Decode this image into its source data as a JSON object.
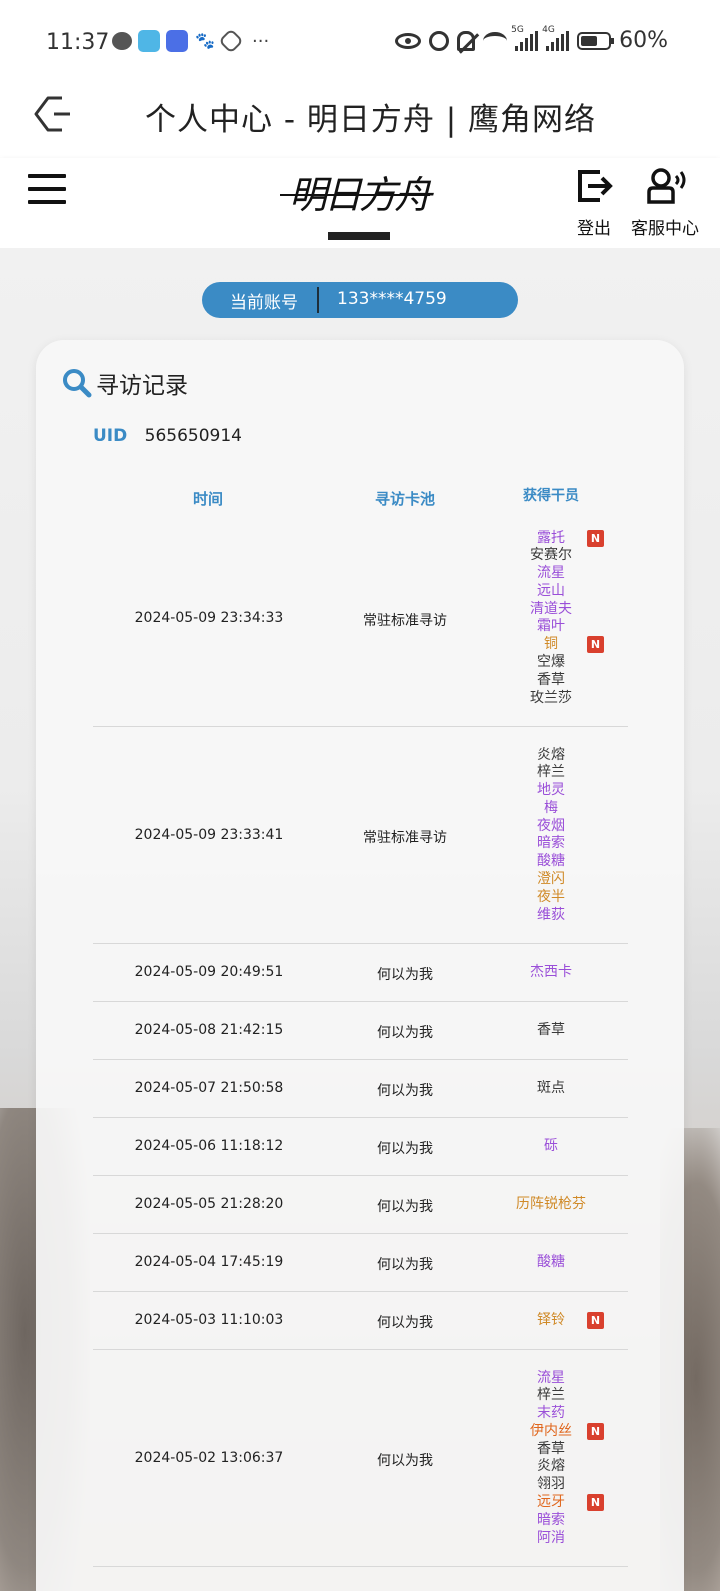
{
  "status_bar": {
    "time": "11:37",
    "notification_icons": [
      "chat-icon",
      "book-app-icon",
      "mail-app-icon",
      "baidu-icon",
      "hand-icon"
    ],
    "more": "···",
    "signal_label_1": "5G",
    "signal_label_2": "4G",
    "battery": "60%"
  },
  "titlebar": {
    "title": "个人中心 - 明日方舟 | 鹰角网络"
  },
  "header": {
    "logo_text": "明日方舟",
    "logout_label": "登出",
    "service_label": "客服中心"
  },
  "account": {
    "label": "当前账号",
    "value": "133****4759"
  },
  "record": {
    "title": "寻访记录",
    "uid_label": "UID",
    "uid_value": "565650914",
    "columns": [
      "时间",
      "寻访卡池",
      "获得干员"
    ],
    "rows": [
      {
        "time": "2024-05-09 23:34:33",
        "pool": "常驻标准寻访",
        "operators": [
          {
            "name": "露托",
            "rarity": 4,
            "new": true
          },
          {
            "name": "安赛尔",
            "rarity": 3,
            "new": false
          },
          {
            "name": "流星",
            "rarity": 4,
            "new": false
          },
          {
            "name": "远山",
            "rarity": 4,
            "new": false
          },
          {
            "name": "清道夫",
            "rarity": 4,
            "new": false
          },
          {
            "name": "霜叶",
            "rarity": 4,
            "new": false
          },
          {
            "name": "铜",
            "rarity": 5,
            "new": true
          },
          {
            "name": "空爆",
            "rarity": 3,
            "new": false
          },
          {
            "name": "香草",
            "rarity": 3,
            "new": false
          },
          {
            "name": "玫兰莎",
            "rarity": 3,
            "new": false
          }
        ]
      },
      {
        "time": "2024-05-09 23:33:41",
        "pool": "常驻标准寻访",
        "operators": [
          {
            "name": "炎熔",
            "rarity": 3,
            "new": false
          },
          {
            "name": "梓兰",
            "rarity": 3,
            "new": false
          },
          {
            "name": "地灵",
            "rarity": 4,
            "new": false
          },
          {
            "name": "梅",
            "rarity": 4,
            "new": false
          },
          {
            "name": "夜烟",
            "rarity": 4,
            "new": false
          },
          {
            "name": "暗索",
            "rarity": 4,
            "new": false
          },
          {
            "name": "酸糖",
            "rarity": 4,
            "new": false
          },
          {
            "name": "澄闪",
            "rarity": 5,
            "new": false
          },
          {
            "name": "夜半",
            "rarity": 5,
            "new": false
          },
          {
            "name": "维荻",
            "rarity": 4,
            "new": false
          }
        ]
      },
      {
        "time": "2024-05-09 20:49:51",
        "pool": "何以为我",
        "operators": [
          {
            "name": "杰西卡",
            "rarity": 4,
            "new": false
          }
        ]
      },
      {
        "time": "2024-05-08 21:42:15",
        "pool": "何以为我",
        "operators": [
          {
            "name": "香草",
            "rarity": 3,
            "new": false
          }
        ]
      },
      {
        "time": "2024-05-07 21:50:58",
        "pool": "何以为我",
        "operators": [
          {
            "name": "斑点",
            "rarity": 3,
            "new": false
          }
        ]
      },
      {
        "time": "2024-05-06 11:18:12",
        "pool": "何以为我",
        "operators": [
          {
            "name": "砾",
            "rarity": 4,
            "new": false
          }
        ]
      },
      {
        "time": "2024-05-05 21:28:20",
        "pool": "何以为我",
        "operators": [
          {
            "name": "历阵锐枪芬",
            "rarity": 5,
            "new": false
          }
        ]
      },
      {
        "time": "2024-05-04 17:45:19",
        "pool": "何以为我",
        "operators": [
          {
            "name": "酸糖",
            "rarity": 4,
            "new": false
          }
        ]
      },
      {
        "time": "2024-05-03 11:10:03",
        "pool": "何以为我",
        "operators": [
          {
            "name": "铎铃",
            "rarity": 5,
            "new": true
          }
        ]
      },
      {
        "time": "2024-05-02 13:06:37",
        "pool": "何以为我",
        "operators": [
          {
            "name": "流星",
            "rarity": 4,
            "new": false
          },
          {
            "name": "梓兰",
            "rarity": 3,
            "new": false
          },
          {
            "name": "末药",
            "rarity": 4,
            "new": false
          },
          {
            "name": "伊内丝",
            "rarity": 6,
            "new": true
          },
          {
            "name": "香草",
            "rarity": 3,
            "new": false
          },
          {
            "name": "炎熔",
            "rarity": 3,
            "new": false
          },
          {
            "name": "翎羽",
            "rarity": 3,
            "new": false
          },
          {
            "name": "远牙",
            "rarity": 6,
            "new": true
          },
          {
            "name": "暗索",
            "rarity": 4,
            "new": false
          },
          {
            "name": "阿消",
            "rarity": 4,
            "new": false
          }
        ]
      }
    ],
    "new_badge": "N"
  },
  "colors": {
    "accent": "#3b8bc5",
    "rarity_3": "#3a3a3a",
    "rarity_4": "#9a4fd8",
    "rarity_5": "#d08a28",
    "rarity_6": "#e0671e",
    "new_badge": "#d9402e"
  }
}
